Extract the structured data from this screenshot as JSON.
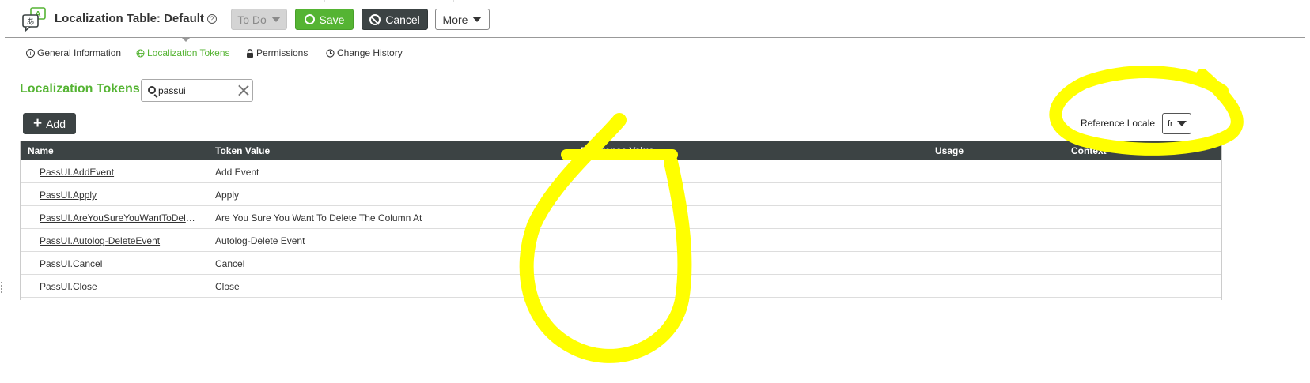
{
  "header": {
    "title": "Localization Table: Default",
    "buttons": {
      "todo": "To Do",
      "save": "Save",
      "cancel": "Cancel",
      "more": "More"
    }
  },
  "tabs": [
    {
      "label": "General Information",
      "icon": "info-icon"
    },
    {
      "label": "Localization Tokens",
      "icon": "globe-icon",
      "active": true
    },
    {
      "label": "Permissions",
      "icon": "lock-icon"
    },
    {
      "label": "Change History",
      "icon": "clock-icon"
    }
  ],
  "section": {
    "title": "Localization Tokens",
    "search_value": "passui",
    "add_label": "Add",
    "reference_locale_label": "Reference Locale",
    "reference_locale_value": "fr"
  },
  "table": {
    "columns": [
      "Name",
      "Token Value",
      "Reference Value",
      "Usage",
      "Context"
    ],
    "rows": [
      {
        "name": "PassUI.AddEvent",
        "value": "Add Event"
      },
      {
        "name": "PassUI.Apply",
        "value": "Apply"
      },
      {
        "name": "PassUI.AreYouSureYouWantToDelet...",
        "value": "Are You Sure You Want To Delete The Column At"
      },
      {
        "name": "PassUI.Autolog-DeleteEvent",
        "value": "Autolog-Delete Event"
      },
      {
        "name": "PassUI.Cancel",
        "value": "Cancel"
      },
      {
        "name": "PassUI.Close",
        "value": "Close"
      }
    ]
  },
  "colors": {
    "accent_green": "#55b433",
    "dark_button": "#3c4344",
    "annotation_yellow": "#ffff00"
  }
}
